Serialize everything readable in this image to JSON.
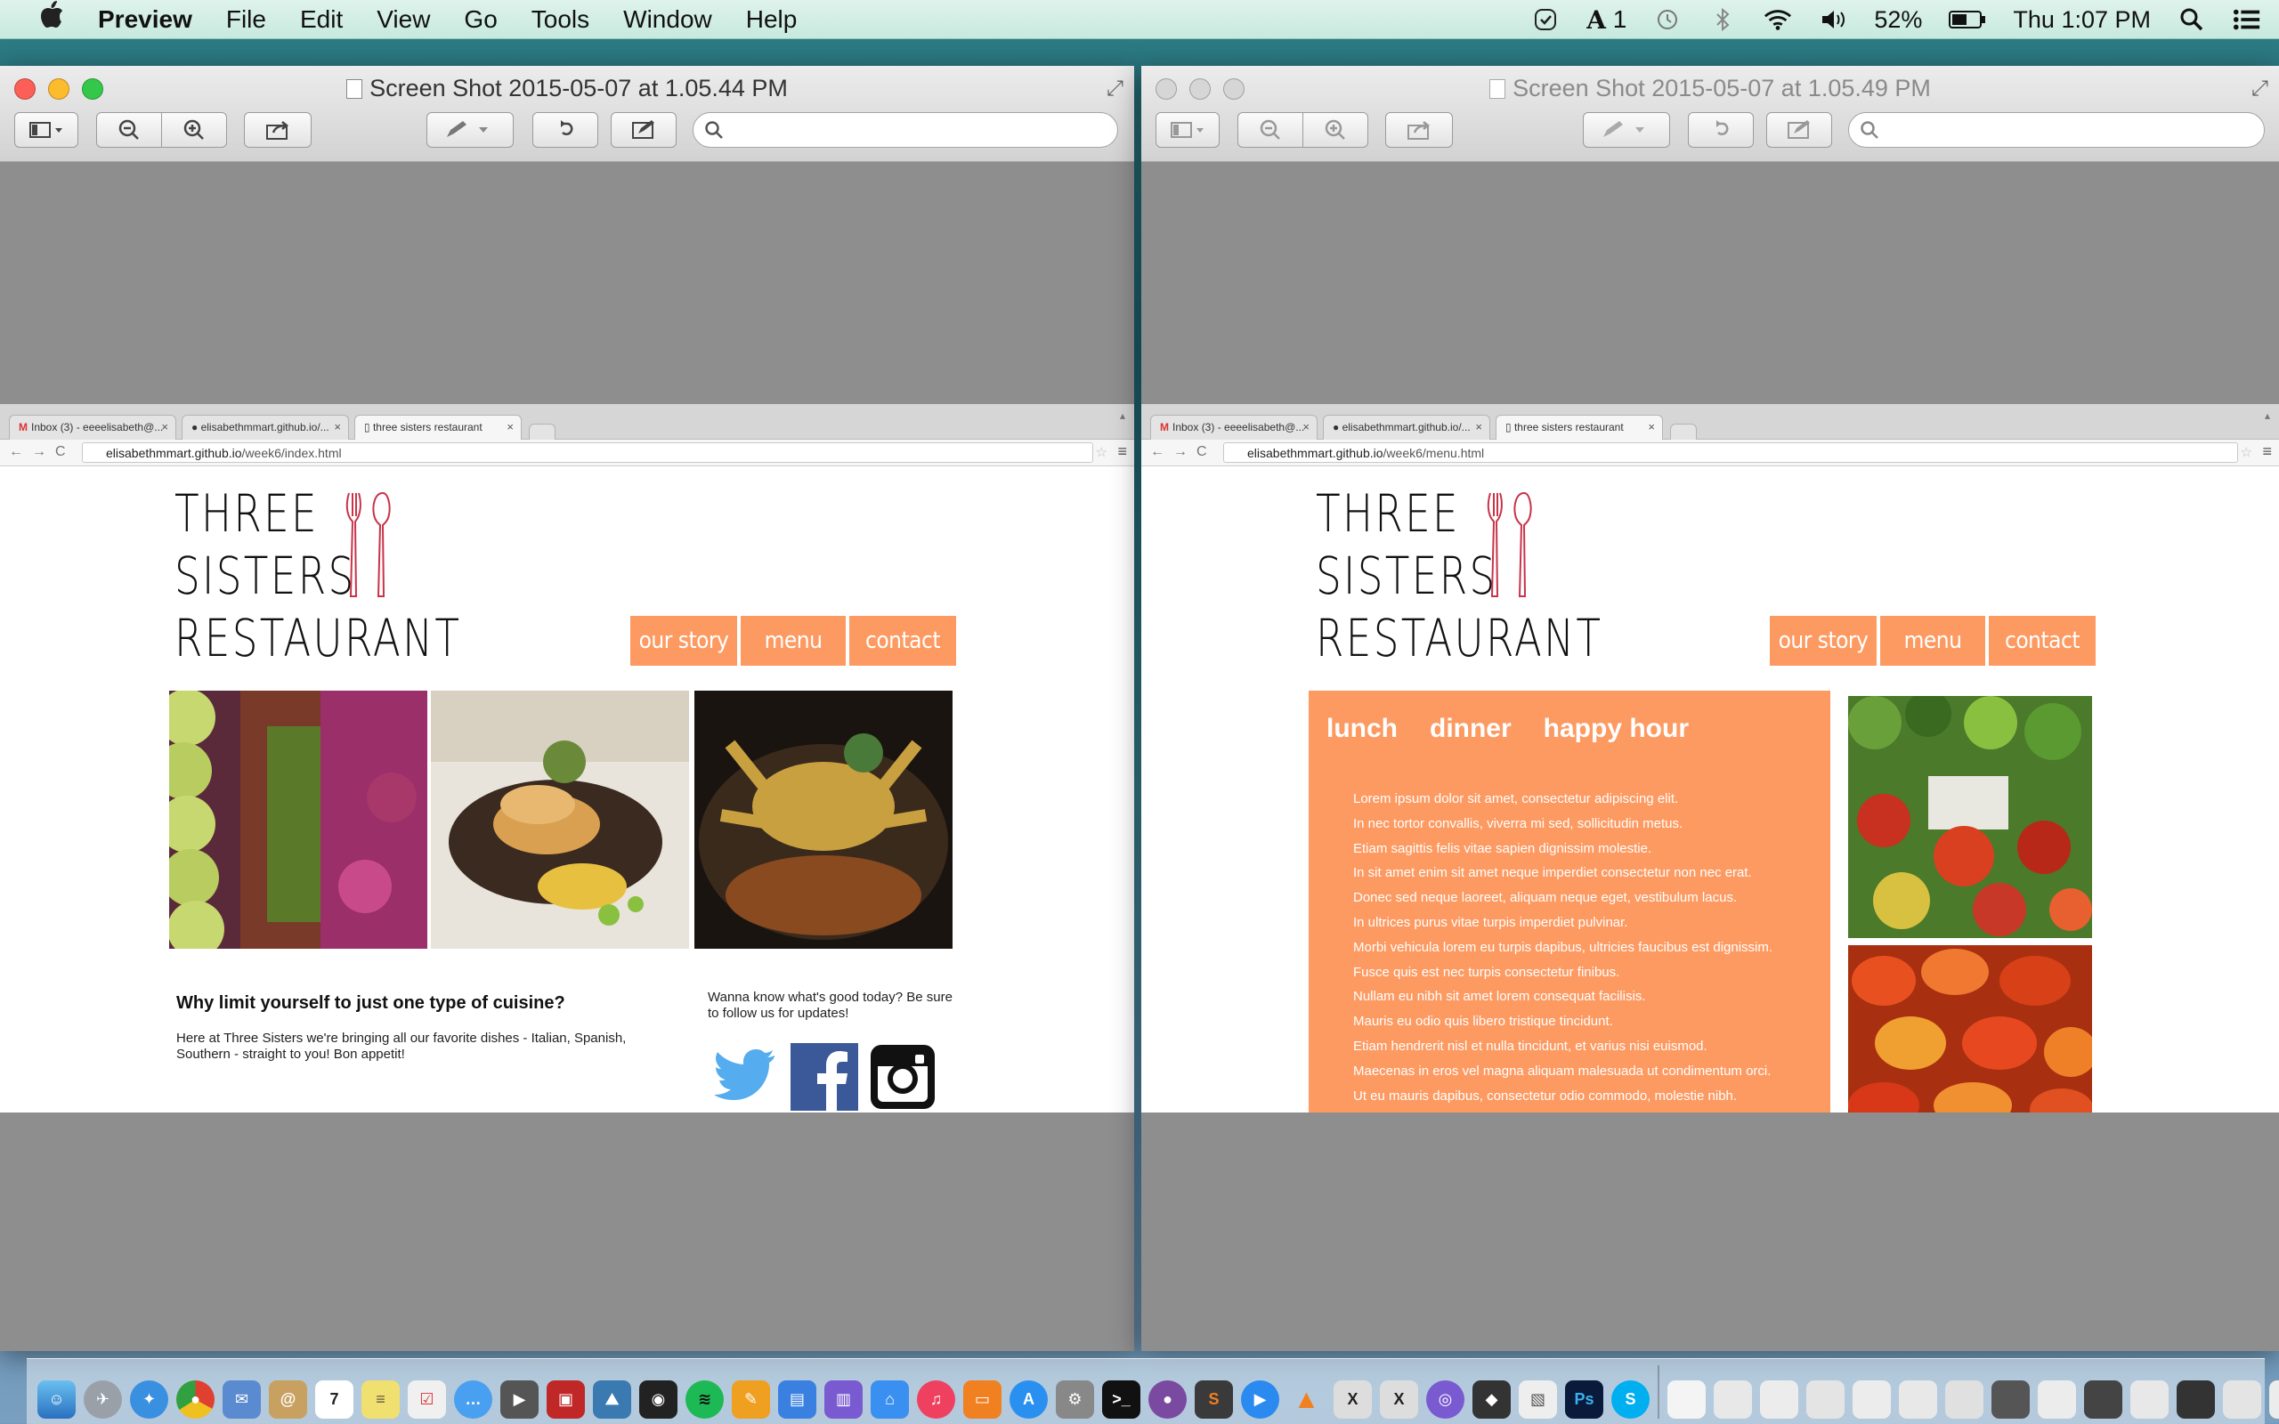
{
  "menubar": {
    "apple": "",
    "app_name": "Preview",
    "menus": [
      "File",
      "Edit",
      "View",
      "Go",
      "Tools",
      "Window",
      "Help"
    ],
    "status_adobe": "1",
    "battery": "52%",
    "clock": "Thu 1:07 PM"
  },
  "windows": [
    {
      "title": "Screen Shot 2015-05-07 at 1.05.44 PM",
      "active": true,
      "browser": {
        "tabs": [
          "Inbox (3) - eeeelisabeth@...",
          "elisabethmmart.github.io/...",
          "three sisters restaurant"
        ],
        "url_host": "elisabethmmart.github.io",
        "url_path": "/week6/index.html"
      }
    },
    {
      "title": "Screen Shot 2015-05-07 at 1.05.49 PM",
      "active": false,
      "browser": {
        "tabs": [
          "Inbox (3) - eeeelisabeth@...",
          "elisabethmmart.github.io/...",
          "three sisters restaurant"
        ],
        "url_host": "elisabethmmart.github.io",
        "url_path": "/week6/menu.html"
      }
    }
  ],
  "site": {
    "logo_lines": [
      "THREE",
      "SISTERS",
      "RESTAURANT"
    ],
    "nav": [
      "our story",
      "menu",
      "contact"
    ],
    "home": {
      "heading": "Why limit yourself to just one type of cuisine?",
      "body": "Here at Three Sisters we're bringing all our favorite dishes - Italian, Spanish, Southern - straight to you! Bon appetit!",
      "follow": "Wanna know what's good today? Be sure to follow us for updates!"
    },
    "menu_page": {
      "tabs": [
        "lunch",
        "dinner",
        "happy hour"
      ],
      "lines": [
        "Lorem ipsum dolor sit amet, consectetur adipiscing elit.",
        "In nec tortor convallis, viverra mi sed, sollicitudin metus.",
        "Etiam sagittis felis vitae sapien dignissim molestie.",
        "In sit amet enim sit amet neque imperdiet consectetur non nec erat.",
        "Donec sed neque laoreet, aliquam neque eget, vestibulum lacus.",
        "In ultrices purus vitae turpis imperdiet pulvinar.",
        "Morbi vehicula lorem eu turpis dapibus, ultricies faucibus est dignissim.",
        "Fusce quis est nec turpis consectetur finibus.",
        "Nullam eu nibh sit amet lorem consequat facilisis.",
        "Mauris eu odio quis libero tristique tincidunt.",
        "Etiam hendrerit nisl et nulla tincidunt, et varius nisi euismod.",
        "Maecenas in eros vel magna aliquam malesuada ut condimentum orci.",
        "Ut eu mauris dapibus, consectetur odio commodo, molestie nibh."
      ]
    }
  },
  "colors": {
    "accent_orange": "#fd9a62",
    "twitter": "#55acee",
    "facebook": "#3b5998"
  }
}
